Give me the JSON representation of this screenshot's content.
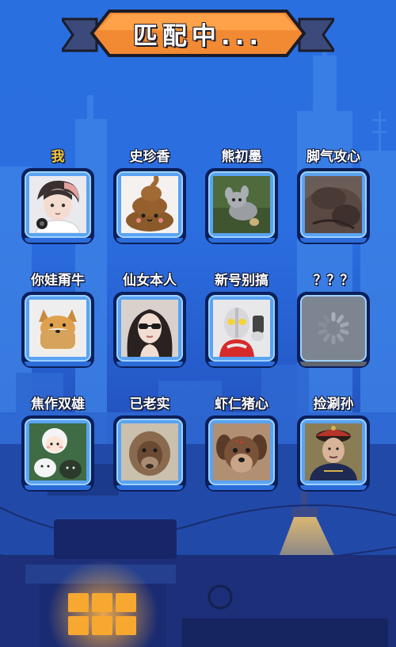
{
  "header": {
    "title": "匹配中..."
  },
  "players": [
    {
      "name": "我",
      "avatar": "anime-boy-avatar",
      "is_self": true
    },
    {
      "name": "史珍香",
      "avatar": "poop-avatar"
    },
    {
      "name": "熊初墨",
      "avatar": "plush-toy-avatar"
    },
    {
      "name": "脚气攻心",
      "avatar": "feet-avatar"
    },
    {
      "name": "你娃甭牛",
      "avatar": "bread-dog-avatar"
    },
    {
      "name": "仙女本人",
      "avatar": "girl-sunglasses-avatar"
    },
    {
      "name": "新号别搞",
      "avatar": "ultraman-avatar"
    },
    {
      "name": "？？？",
      "avatar": "loading-spinner-icon",
      "is_loading": true
    },
    {
      "name": "焦作双雄",
      "avatar": "cartoon-duo-avatar"
    },
    {
      "name": "已老实",
      "avatar": "orangutan-avatar"
    },
    {
      "name": "虾仁猪心",
      "avatar": "puppy-avatar"
    },
    {
      "name": "捡涮孙",
      "avatar": "qing-official-avatar"
    }
  ],
  "footer": {
    "menu_icon": "grid-menu-icon"
  },
  "colors": {
    "accent": "#f7a831",
    "self_name": "#f7cc3f",
    "card_face": "#5aa3f2",
    "background": "#2a6fe0"
  }
}
